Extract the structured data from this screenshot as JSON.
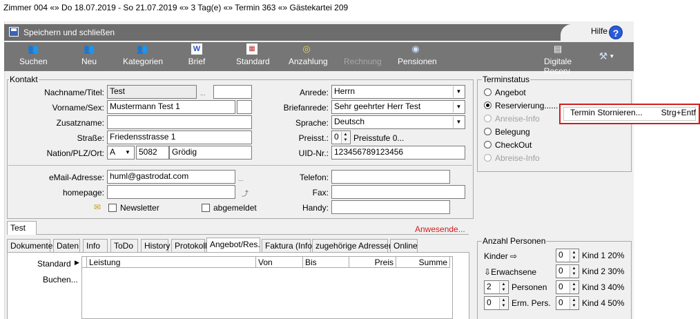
{
  "window_title": "Zimmer 004 «» Do 18.07.2019 - So 21.07.2019 «» 3 Tag(e) «» Termin 363 «» Gästekartei 209",
  "savebar": {
    "label": "Speichern und schließen",
    "help": "Hilfe",
    "help_icon": "?"
  },
  "toolbar": [
    {
      "label": "Suchen",
      "icon": "people-search-icon",
      "glyph": "👥",
      "disabled": false
    },
    {
      "label": "Neu",
      "icon": "people-new-icon",
      "glyph": "👥",
      "disabled": false
    },
    {
      "label": "Kategorien",
      "icon": "categories-icon",
      "glyph": "👥",
      "disabled": false
    },
    {
      "label": "Brief",
      "icon": "word-document-icon",
      "glyph": "W",
      "disabled": false
    },
    {
      "label": "Standard",
      "icon": "standard-document-icon",
      "glyph": "▦",
      "disabled": false
    },
    {
      "label": "Anzahlung",
      "icon": "deposit-icon",
      "glyph": "◎",
      "disabled": false
    },
    {
      "label": "Rechnung",
      "icon": "invoice-icon",
      "glyph": "",
      "disabled": true
    },
    {
      "label": "Pensionen",
      "icon": "pension-icon",
      "glyph": "◉",
      "disabled": false
    },
    {
      "label": "Digitale Reserv.",
      "icon": "digital-reservation-icon",
      "glyph": "▤",
      "disabled": false
    }
  ],
  "kontakt": {
    "legend": "Kontakt",
    "nachname_label": "Nachname/Titel:",
    "nachname": "Test",
    "ellipsis": "...",
    "vorname_label": "Vorname/Sex:",
    "vorname": "Mustermann Test 1",
    "zusatz_label": "Zusatzname:",
    "strasse_label": "Straße:",
    "strasse": "Friedensstrasse 1",
    "nation_label": "Nation/PLZ/Ort:",
    "nation": "A",
    "plz": "5082",
    "ort": "Grödig",
    "anrede_label": "Anrede:",
    "anrede": "Herrn",
    "briefanrede_label": "Briefanrede:",
    "briefanrede": "Sehr geehrter Herr Test",
    "sprache_label": "Sprache:",
    "sprache": "Deutsch",
    "preisst_label": "Preisst.:",
    "preisst": "0",
    "preisstufe": "Preisstufe 0...",
    "uid_label": "UID-Nr.:",
    "uid": "123456789123456",
    "email_label": "eMail-Adresse:",
    "email": "huml@gastrodat.com",
    "homepage_label": "homepage:",
    "telefon_label": "Telefon:",
    "fax_label": "Fax:",
    "handy_label": "Handy:",
    "newsletter": "Newsletter",
    "abgemeldet": "abgemeldet"
  },
  "terminstatus": {
    "legend": "Terminstatus",
    "options": [
      {
        "label": "Angebot",
        "checked": false,
        "disabled": false
      },
      {
        "label": "Reservierung......",
        "checked": true,
        "disabled": false
      },
      {
        "label": "Anreise-Info",
        "checked": false,
        "disabled": true
      },
      {
        "label": "Belegung",
        "checked": false,
        "disabled": false
      },
      {
        "label": "CheckOut",
        "checked": false,
        "disabled": false
      },
      {
        "label": "Abreise-Info",
        "checked": false,
        "disabled": true
      }
    ]
  },
  "context_menu": {
    "item": "Termin Stornieren...",
    "shortcut": "Strg+Entf"
  },
  "test_tab": "Test",
  "anwesende": "Anwesende...",
  "tabs": [
    "Dokumente",
    "Daten",
    "Info",
    "ToDo",
    "History",
    "Protokoll",
    "Angebot/Res.",
    "Faktura (Info)",
    "zugehörige Adressen",
    "Online"
  ],
  "left_menu": {
    "standard": "Standard",
    "buchen": "Buchen..."
  },
  "grid_headers": [
    "Leistung",
    "Von",
    "Bis",
    "Preis",
    "Summe"
  ],
  "anzahl": {
    "legend": "Anzahl Personen",
    "kinder": "Kinder",
    "erwachsene": "Erwachsene",
    "personen": "Personen",
    "erm_pers": "Erm. Pers.",
    "personen_val": "2",
    "erm_val": "0",
    "kind": [
      {
        "label": "Kind 1 20%",
        "value": "0"
      },
      {
        "label": "Kind 2 30%",
        "value": "0"
      },
      {
        "label": "Kind 3 40%",
        "value": "0"
      },
      {
        "label": "Kind 4 50%",
        "value": "0"
      }
    ]
  },
  "colors": {
    "toolbar_bg": "#767676",
    "savebar_bg": "#6d6d6d",
    "highlight": "#d51a1a",
    "anwesende": "#d51a1a"
  }
}
